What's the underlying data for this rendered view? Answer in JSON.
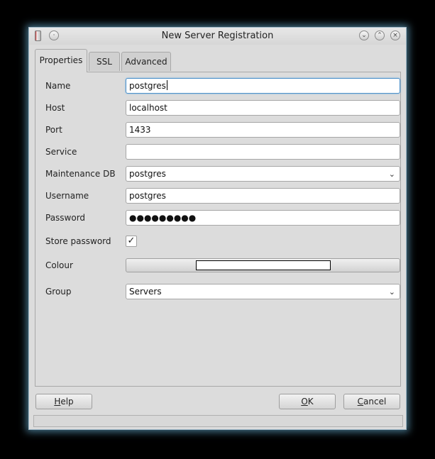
{
  "window": {
    "title": "New Server Registration",
    "icons": [
      "app-icon",
      "help-dot-icon",
      "minimize-icon",
      "maximize-icon",
      "close-icon"
    ]
  },
  "tabs": [
    {
      "label": "Properties",
      "active": true
    },
    {
      "label": "SSL",
      "active": false
    },
    {
      "label": "Advanced",
      "active": false
    }
  ],
  "form": {
    "name": {
      "label": "Name",
      "value": "postgres"
    },
    "host": {
      "label": "Host",
      "value": "localhost"
    },
    "port": {
      "label": "Port",
      "value": "1433"
    },
    "service": {
      "label": "Service",
      "value": ""
    },
    "maintenance_db": {
      "label": "Maintenance DB",
      "value": "postgres"
    },
    "username": {
      "label": "Username",
      "value": "postgres"
    },
    "password": {
      "label": "Password",
      "value": "●●●●●●●●●"
    },
    "store_password": {
      "label": "Store password",
      "checked": true,
      "check_glyph": "✓"
    },
    "colour": {
      "label": "Colour",
      "swatch": "#ffffff"
    },
    "group": {
      "label": "Group",
      "value": "Servers"
    }
  },
  "buttons": {
    "help": {
      "mnemonic": "H",
      "rest": "elp"
    },
    "ok": {
      "mnemonic": "O",
      "rest": "K"
    },
    "cancel": {
      "mnemonic": "C",
      "rest": "ancel"
    }
  },
  "colors": {
    "window_glow": "#78c8f0",
    "focus_border": "#4d90c8"
  }
}
